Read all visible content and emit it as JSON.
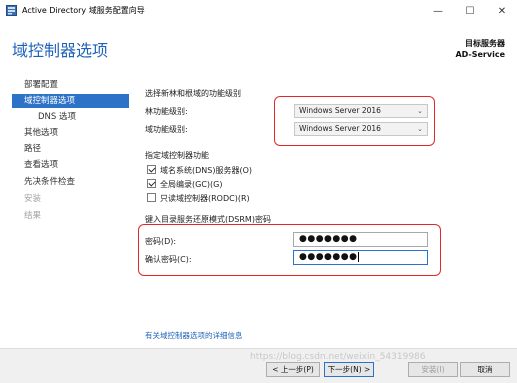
{
  "window": {
    "title": "Active Directory 域服务配置向导",
    "minimize": "—",
    "maximize": "☐",
    "close": "✕"
  },
  "header": {
    "page_title": "域控制器选项",
    "target_label": "目标服务器",
    "target_server": "AD-Service"
  },
  "sidebar": {
    "items": [
      {
        "label": "部署配置",
        "state": "normal"
      },
      {
        "label": "域控制器选项",
        "state": "active"
      },
      {
        "label": "DNS 选项",
        "state": "sub"
      },
      {
        "label": "其他选项",
        "state": "normal"
      },
      {
        "label": "路径",
        "state": "normal"
      },
      {
        "label": "查看选项",
        "state": "normal"
      },
      {
        "label": "先决条件检查",
        "state": "normal"
      },
      {
        "label": "安装",
        "state": "disabled"
      },
      {
        "label": "结果",
        "state": "disabled"
      }
    ]
  },
  "main": {
    "section_functional_level": "选择新林和根域的功能级别",
    "forest_level_label": "林功能级别:",
    "forest_level_value": "Windows Server 2016",
    "domain_level_label": "域功能级别:",
    "domain_level_value": "Windows Server 2016",
    "section_dc_capabilities": "指定域控制器功能",
    "dns_server_label": "域名系统(DNS)服务器(O)",
    "dns_server_checked": true,
    "global_catalog_label": "全局编录(GC)(G)",
    "global_catalog_checked": true,
    "rodc_label": "只读域控制器(RODC)(R)",
    "rodc_checked": false,
    "section_dsrm": "键入目录服务还原模式(DSRM)密码",
    "password_label": "密码(D):",
    "password_value": "●●●●●●●",
    "confirm_label": "确认密码(C):",
    "confirm_value": "●●●●●●●",
    "more_info_link": "有关域控制器选项的详细信息"
  },
  "footer": {
    "back_button": "< 上一步(P)",
    "next_button": "下一步(N) >",
    "install_button": "安装(I)",
    "cancel_button": "取消"
  },
  "watermark": "https://blog.csdn.net/weixin_54319986",
  "colors": {
    "accent": "#2c72c7",
    "title_blue": "#1f63b8",
    "highlight_red": "#e0292b"
  }
}
